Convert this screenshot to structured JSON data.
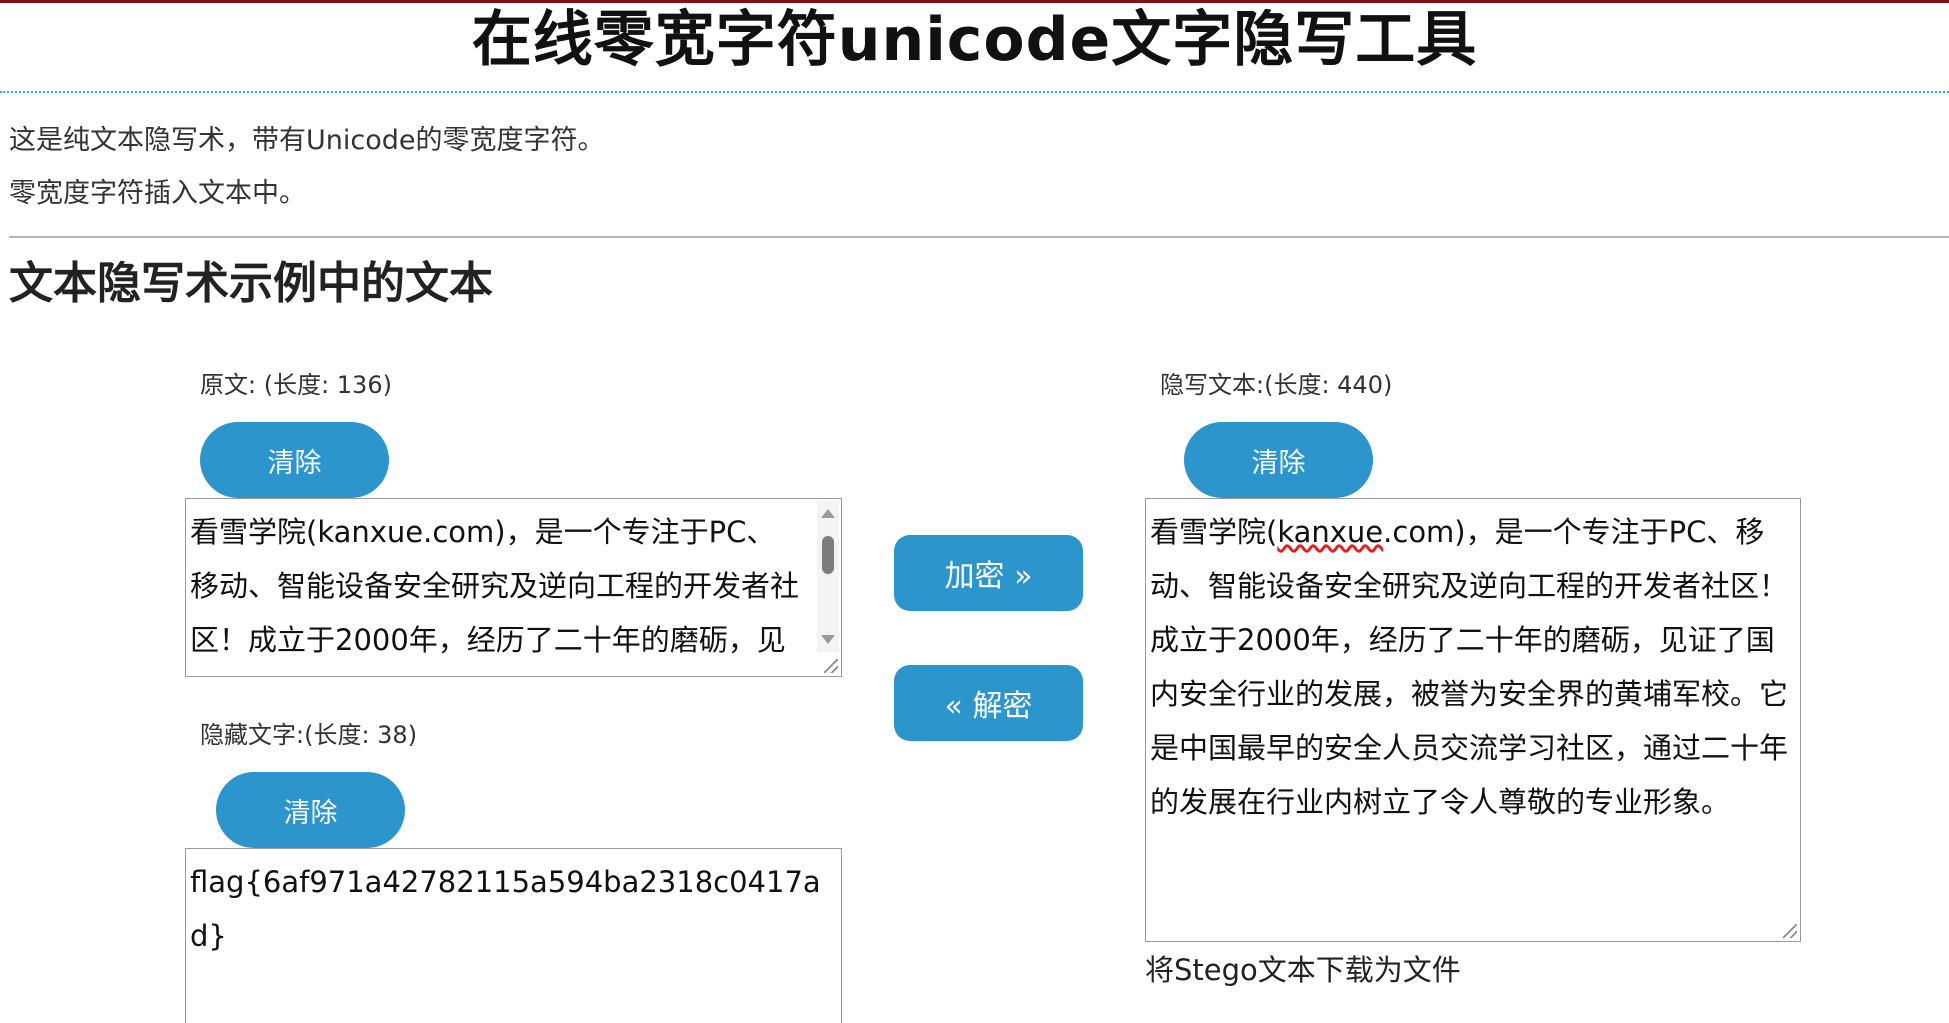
{
  "header": {
    "title": "在线零宽字符unicode文字隐写工具"
  },
  "intro": {
    "line1": "这是纯文本隐写术，带有Unicode的零宽度字符。",
    "line2": "零宽度字符插入文本中。"
  },
  "section": {
    "title": "文本隐写术示例中的文本"
  },
  "original": {
    "label": "原文: (长度: 136)",
    "clear_label": "清除",
    "text": "看雪学院(kanxue.com)，是一个专注于PC、移动、智能设备安全研究及逆向工程的开发者社区！成立于2000年，经历了二十年的磨砺，见"
  },
  "hidden": {
    "label": "隐藏文字:(长度: 38)",
    "clear_label": "清除",
    "text": "flag{6af971a42782115a594ba2318c0417ad}"
  },
  "actions": {
    "encrypt_label": "加密 »",
    "decrypt_label": "« 解密"
  },
  "stego": {
    "label": "隐写文本:(长度: 440)",
    "clear_label": "清除",
    "text_before": "看雪学院(",
    "text_underlined": "kanxue",
    "text_after": ".com)，是一个专注于PC、移动、智能设备安全研究及逆向工程的开发者社区！成立于2000年，经历了二十年的磨砺，见证了国内安全行业的发展，被誉为安全界的黄埔军校。它是中国最早的安全人员交流学习社区，通过二十年的发展在行业内树立了令人尊敬的专业形象。",
    "download_label": "将Stego文本下载为文件"
  },
  "colors": {
    "accent": "#2b95cc",
    "top_line": "#7b1416",
    "divider_dotted": "#35b4c8",
    "spellcheck": "#e02020"
  }
}
